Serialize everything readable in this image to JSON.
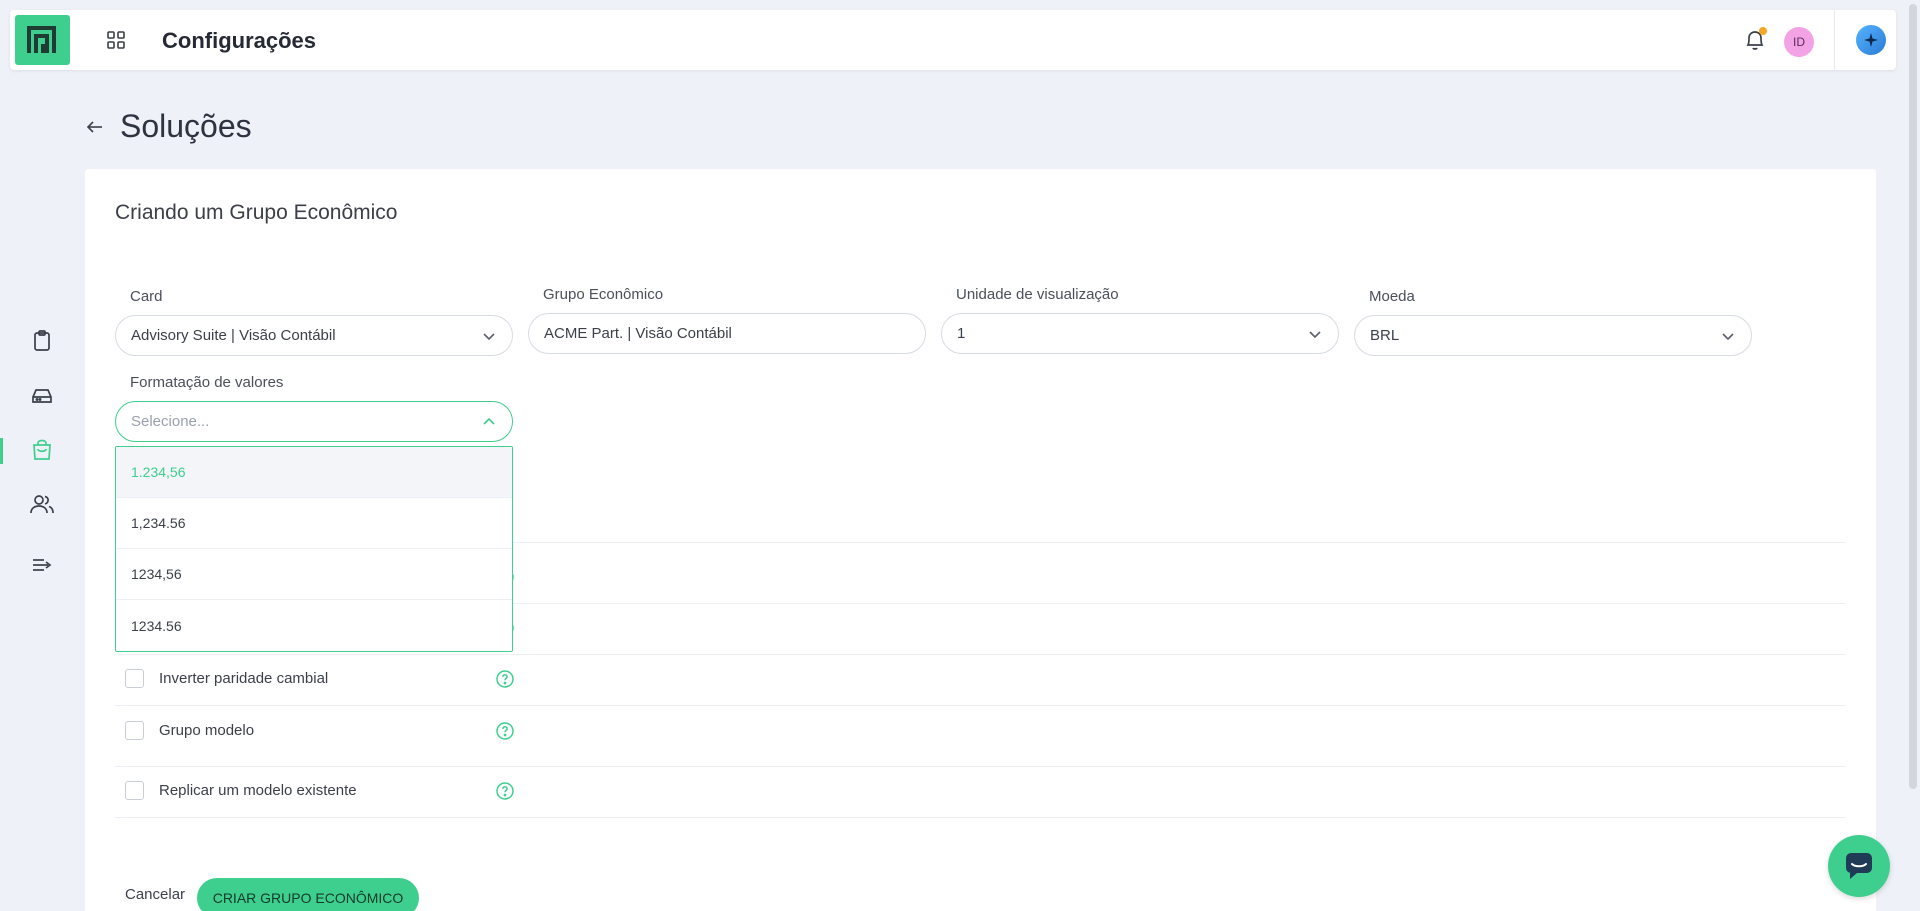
{
  "topbar": {
    "title": "Configurações",
    "avatar_initials": "ID"
  },
  "icons": {
    "logo": "logo-icon",
    "apps": "grid-icon",
    "notifications": "bell-icon",
    "assistant": "sparkle-icon",
    "back": "arrow-left-icon",
    "chat": "chat-icon"
  },
  "sidebar": {
    "items": [
      {
        "icon": "clipboard-icon",
        "active": false
      },
      {
        "icon": "storage-icon",
        "active": false
      },
      {
        "icon": "shopping-bag-icon",
        "active": true
      },
      {
        "icon": "users-icon",
        "active": false
      },
      {
        "icon": "list-arrow-icon",
        "active": false
      }
    ]
  },
  "page": {
    "title": "Soluções"
  },
  "form": {
    "title": "Criando um Grupo Econômico",
    "card": {
      "label": "Card",
      "value": "Advisory Suite | Visão Contábil"
    },
    "grupo": {
      "label": "Grupo Econômico",
      "value": "ACME Part. | Visão Contábil"
    },
    "unidade": {
      "label": "Unidade de visualização",
      "value": "1"
    },
    "moeda": {
      "label": "Moeda",
      "value": "BRL"
    },
    "formatacao": {
      "label": "Formatação de valores",
      "placeholder": "Selecione...",
      "options": [
        "1.234,56",
        "1,234.56",
        "1234,56",
        "1234.56"
      ],
      "highlighted_index": 0
    },
    "checkboxes": [
      {
        "label": "Inverter paridade cambial",
        "checked": false
      },
      {
        "label": "Grupo modelo",
        "checked": false
      },
      {
        "label": "Replicar um modelo existente",
        "checked": false
      }
    ],
    "cancel_label": "Cancelar",
    "submit_label": "CRIAR GRUPO ECONÔMICO"
  },
  "colors": {
    "accent": "#3ecf8e",
    "background": "#eef1f7",
    "notification_dot": "#f5a623",
    "avatar": "#f3a2e6"
  }
}
